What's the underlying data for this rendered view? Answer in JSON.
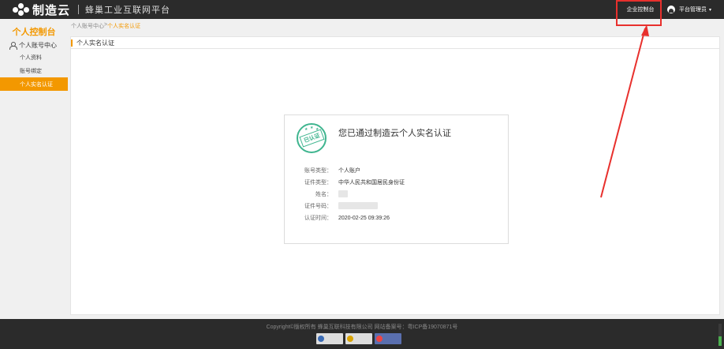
{
  "header": {
    "logo_text": "制造云",
    "platform_name": "蜂巢工业互联网平台",
    "enterprise_console": "企业控制台",
    "user_name": "平台管理员",
    "caret": "▾"
  },
  "sidebar": {
    "title": "个人控制台",
    "group_label": "个人账号中心",
    "items": [
      {
        "label": "个人资料"
      },
      {
        "label": "账号绑定"
      },
      {
        "label": "个人实名认证"
      }
    ]
  },
  "breadcrumb": {
    "parent": "个人账号中心",
    "separator": ">",
    "current": "个人实名认证"
  },
  "panel": {
    "title": "个人实名认证"
  },
  "card": {
    "stamp_text": "已认证",
    "title": "您已通过制造云个人实名认证",
    "fields": [
      {
        "key": "账号类型：",
        "value": "个人账户"
      },
      {
        "key": "证件类型：",
        "value": "中华人民共和国居民身份证"
      },
      {
        "key": "姓名：",
        "value": ""
      },
      {
        "key": "证件号码：",
        "value": ""
      },
      {
        "key": "认证时间：",
        "value": "2020-02-25 09:39:26"
      }
    ]
  },
  "footer": {
    "copyright": "Copyright©版权所有   蜂巢互联科技有限公司   网站备案号：粤ICP备19070871号"
  },
  "colors": {
    "accent": "#f39800",
    "header_bg": "#2b2b2b",
    "stamp_green": "#3fb58f",
    "annotation_red": "#e8302d"
  }
}
